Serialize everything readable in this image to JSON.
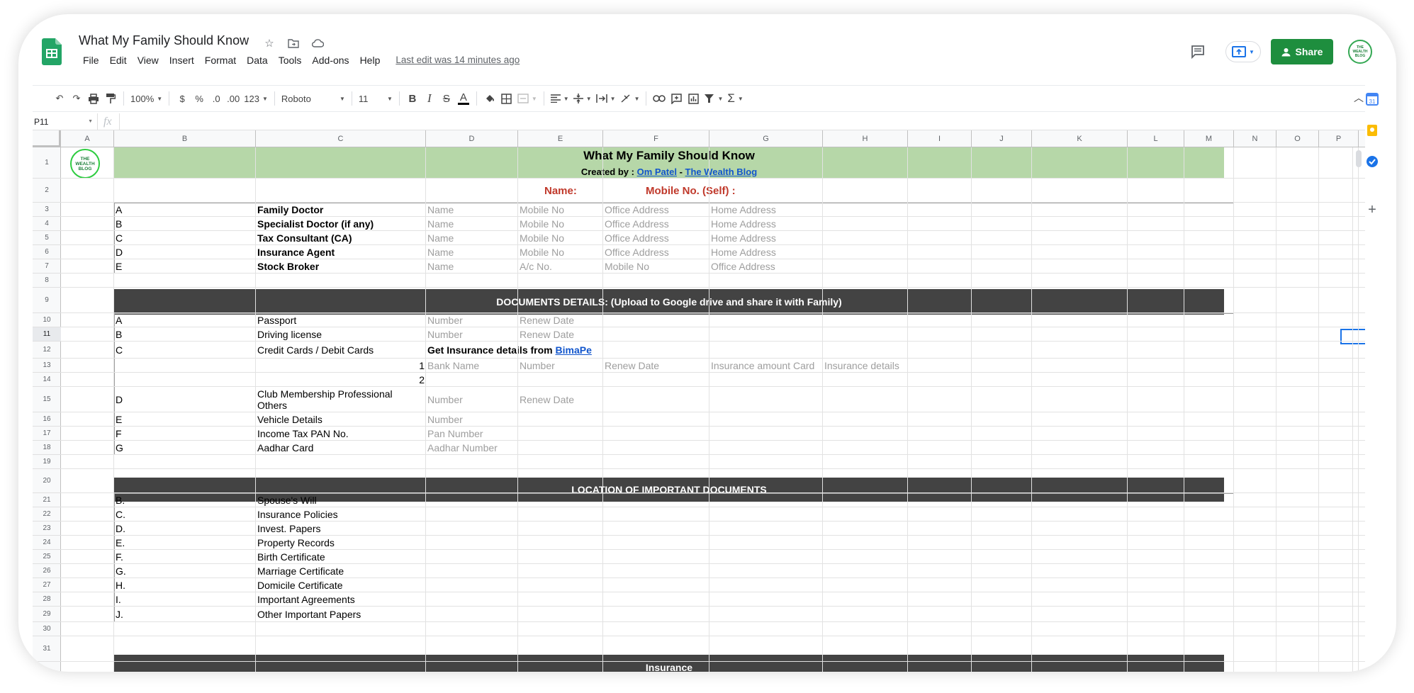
{
  "header": {
    "doc_title": "What My Family Should Know",
    "menu": [
      "File",
      "Edit",
      "View",
      "Insert",
      "Format",
      "Data",
      "Tools",
      "Add-ons",
      "Help"
    ],
    "last_edit": "Last edit was 14 minutes ago",
    "share_label": "Share",
    "avatar_text": "THE WEALTH BLOG"
  },
  "toolbar": {
    "zoom": "100%",
    "currency": "$",
    "percent": "%",
    "dec_decrease": ".0",
    "dec_increase": ".00",
    "more_formats": "123",
    "font": "Roboto",
    "font_size": "11",
    "bold": "B",
    "italic": "I",
    "strike": "S",
    "text_color": "A"
  },
  "formula_bar": {
    "name_box": "P11",
    "fx": "fx",
    "value": ""
  },
  "columns": [
    "A",
    "B",
    "C",
    "D",
    "E",
    "F",
    "G",
    "H",
    "I",
    "J",
    "K",
    "L",
    "M",
    "N",
    "O",
    "P"
  ],
  "rows": [
    "1",
    "2",
    "3",
    "4",
    "5",
    "6",
    "7",
    "8",
    "9",
    "10",
    "11",
    "12",
    "13",
    "14",
    "15",
    "16",
    "17",
    "18",
    "19",
    "20",
    "21",
    "22",
    "23",
    "24",
    "25",
    "26",
    "27",
    "28",
    "29",
    "30",
    "31"
  ],
  "selected": {
    "cell": "P11",
    "row": "11"
  },
  "sheet": {
    "logo_text": "THE WEALTH BLOG",
    "title": "What My Family Should Know",
    "created_by": "Created by :",
    "author": "Om Patel",
    "dash": "-",
    "blog": "The Wealth Blog",
    "name_label": "Name:",
    "mobile_label": "Mobile No. (Self) :",
    "contacts": [
      {
        "letter": "A",
        "label": "Family Doctor",
        "d": "Name",
        "e": "Mobile No",
        "f": "Office Address",
        "g": "Home Address"
      },
      {
        "letter": "B",
        "label": "Specialist Doctor (if any)",
        "d": "Name",
        "e": "Mobile No",
        "f": "Office Address",
        "g": "Home Address"
      },
      {
        "letter": "C",
        "label": "Tax Consultant (CA)",
        "d": "Name",
        "e": "Mobile No",
        "f": "Office Address",
        "g": "Home Address"
      },
      {
        "letter": "D",
        "label": "Insurance Agent",
        "d": "Name",
        "e": "Mobile No",
        "f": "Office Address",
        "g": "Home Address"
      },
      {
        "letter": "E",
        "label": "Stock Broker",
        "d": "Name",
        "e": "A/c No.",
        "f": "Mobile No",
        "g": "Office Address"
      }
    ],
    "docs_header_bold": "DOCUMENTS DETAILS:",
    "docs_header_rest": "(Upload to Google drive and share it with Family)",
    "docs": {
      "passport": {
        "letter": "A",
        "label": "Passport",
        "d": "Number",
        "e": "Renew Date"
      },
      "driving": {
        "letter": "B",
        "label": "Driving license",
        "d": "Number",
        "e": "Renew Date"
      },
      "cards": {
        "letter": "C",
        "label": "Credit Cards / Debit Cards",
        "ins_text": "Get Insurance details from",
        "ins_link": "BimaPe"
      },
      "card_row1": {
        "num": "1",
        "d": "Bank Name",
        "e": "Number",
        "f": "Renew Date",
        "g": "Insurance amount Card",
        "h": "Insurance details"
      },
      "card_row2": {
        "num": "2"
      },
      "club": {
        "letter": "D",
        "label": "Club Membership Professional Others",
        "d": "Number",
        "e": "Renew Date"
      },
      "vehicle": {
        "letter": "E",
        "label": "Vehicle Details",
        "d": "Number"
      },
      "pan": {
        "letter": "F",
        "label": "Income Tax PAN No.",
        "d": "Pan Number"
      },
      "aadhar": {
        "letter": "G",
        "label": "Aadhar Card",
        "d": "Aadhar Number"
      }
    },
    "location_header": "LOCATION OF IMPORTANT DOCUMENTS",
    "locations": [
      {
        "letter": "B.",
        "label": "Spouse's Will"
      },
      {
        "letter": "C.",
        "label": "Insurance Policies"
      },
      {
        "letter": "D.",
        "label": "Invest. Papers"
      },
      {
        "letter": "E.",
        "label": "Property Records"
      },
      {
        "letter": "F.",
        "label": "Birth Certificate"
      },
      {
        "letter": "G.",
        "label": "Marriage Certificate"
      },
      {
        "letter": "H.",
        "label": "Domicile Certificate"
      },
      {
        "letter": "I.",
        "label": "Important Agreements"
      },
      {
        "letter": "J.",
        "label": "Other Important Papers"
      }
    ],
    "insurance_header": "Insurance"
  },
  "colors": {
    "green_band": "#b6d7a8",
    "dark_band": "#434343",
    "share": "#1e8e3e",
    "link": "#1155cc",
    "red": "#c0392b"
  }
}
